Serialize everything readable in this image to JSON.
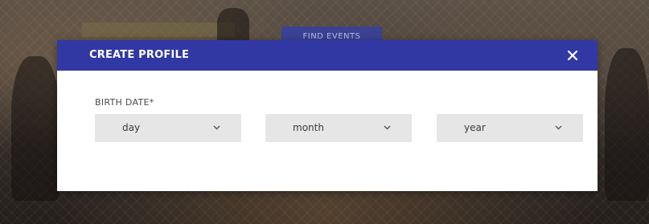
{
  "background": {
    "tab_label": "FIND EVENTS"
  },
  "modal": {
    "title": "CREATE PROFILE",
    "close_icon": "close-icon",
    "birth_date": {
      "label": "BIRTH DATE*",
      "selects": [
        {
          "value": "day",
          "icon": "chevron-down-icon"
        },
        {
          "value": "month",
          "icon": "chevron-down-icon"
        },
        {
          "value": "year",
          "icon": "chevron-down-icon"
        }
      ]
    }
  },
  "colors": {
    "header": "#3238a3",
    "select_bg": "#e6e6e6"
  }
}
